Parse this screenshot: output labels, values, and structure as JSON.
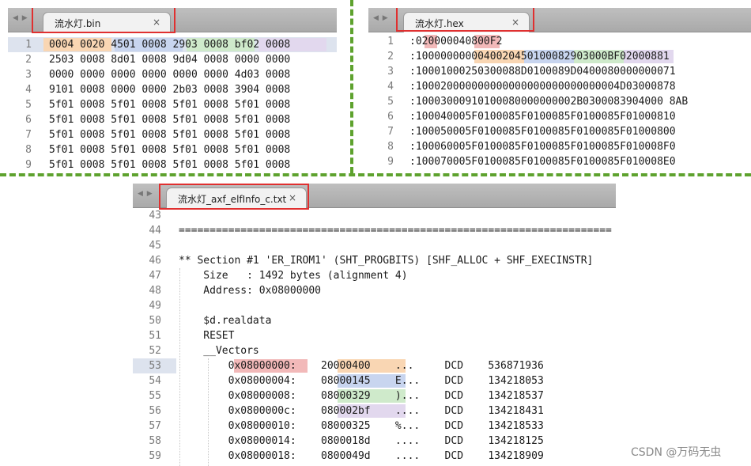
{
  "colors": {
    "orange": "#f9d6b3",
    "blue": "#c8d5ef",
    "green": "#cfeacb",
    "purple": "#e2d8ee",
    "pink": "#f2b9b9",
    "red_box": "#e03030",
    "separator": "#5ea22e"
  },
  "bin": {
    "tab_label": "流水灯.bin",
    "close": "×",
    "lines": [
      {
        "n": "1",
        "text": "0004 0020 4501 0008 2903 0008 bf02 0008"
      },
      {
        "n": "2",
        "text": "2503 0008 8d01 0008 9d04 0008 0000 0000"
      },
      {
        "n": "3",
        "text": "0000 0000 0000 0000 0000 0000 4d03 0008"
      },
      {
        "n": "4",
        "text": "9101 0008 0000 0000 2b03 0008 3904 0008"
      },
      {
        "n": "5",
        "text": "5f01 0008 5f01 0008 5f01 0008 5f01 0008"
      },
      {
        "n": "6",
        "text": "5f01 0008 5f01 0008 5f01 0008 5f01 0008"
      },
      {
        "n": "7",
        "text": "5f01 0008 5f01 0008 5f01 0008 5f01 0008"
      },
      {
        "n": "8",
        "text": "5f01 0008 5f01 0008 5f01 0008 5f01 0008"
      },
      {
        "n": "9",
        "text": "5f01 0008 5f01 0008 5f01 0008 5f01 0008"
      }
    ]
  },
  "hex": {
    "tab_label": "流水灯.hex",
    "close": "×",
    "lines": [
      {
        "n": "1",
        "text": ":020000040800F2"
      },
      {
        "n": "2",
        "text": ":1000000000040020450100082903000BF02000881"
      },
      {
        "n": "3",
        "text": ":10001000250300088D0100089D0400080000000071"
      },
      {
        "n": "4",
        "text": ":100020000000000000000000000000004D03000878"
      },
      {
        "n": "5",
        "text": ":10003000910100080000000002B0300083904000 8AB"
      },
      {
        "n": "6",
        "text": ":100040005F0100085F0100085F0100085F01000810"
      },
      {
        "n": "7",
        "text": ":100050005F0100085F0100085F0100085F01000800"
      },
      {
        "n": "8",
        "text": ":100060005F0100085F0100085F0100085F010008F0"
      },
      {
        "n": "9",
        "text": ":100070005F0100085F0100085F0100085F010008E0"
      }
    ]
  },
  "elf": {
    "tab_label": "流水灯_axf_elfInfo_c.txt",
    "close": "×",
    "lines": [
      {
        "n": "43",
        "text": ""
      },
      {
        "n": "44",
        "text": "======================================================================"
      },
      {
        "n": "45",
        "text": ""
      },
      {
        "n": "46",
        "text": "** Section #1 'ER_IROM1' (SHT_PROGBITS) [SHF_ALLOC + SHF_EXECINSTR]"
      },
      {
        "n": "47",
        "text": "    Size   : 1492 bytes (alignment 4)"
      },
      {
        "n": "48",
        "text": "    Address: 0x08000000"
      },
      {
        "n": "49",
        "text": ""
      },
      {
        "n": "50",
        "text": "    $d.realdata"
      },
      {
        "n": "51",
        "text": "    RESET"
      },
      {
        "n": "52",
        "text": "    __Vectors"
      },
      {
        "n": "53",
        "text": "        0x08000000:    20000400    ...     DCD    536871936"
      },
      {
        "n": "54",
        "text": "        0x08000004:    08000145    E...    DCD    134218053"
      },
      {
        "n": "55",
        "text": "        0x08000008:    08000329    )...    DCD    134218537"
      },
      {
        "n": "56",
        "text": "        0x0800000c:    080002bf    ....    DCD    134218431"
      },
      {
        "n": "57",
        "text": "        0x08000010:    08000325    %...    DCD    134218533"
      },
      {
        "n": "58",
        "text": "        0x08000014:    0800018d    ....    DCD    134218125"
      },
      {
        "n": "59",
        "text": "        0x08000018:    0800049d    ....    DCD    134218909"
      }
    ]
  },
  "watermark": "CSDN @万码无虫"
}
